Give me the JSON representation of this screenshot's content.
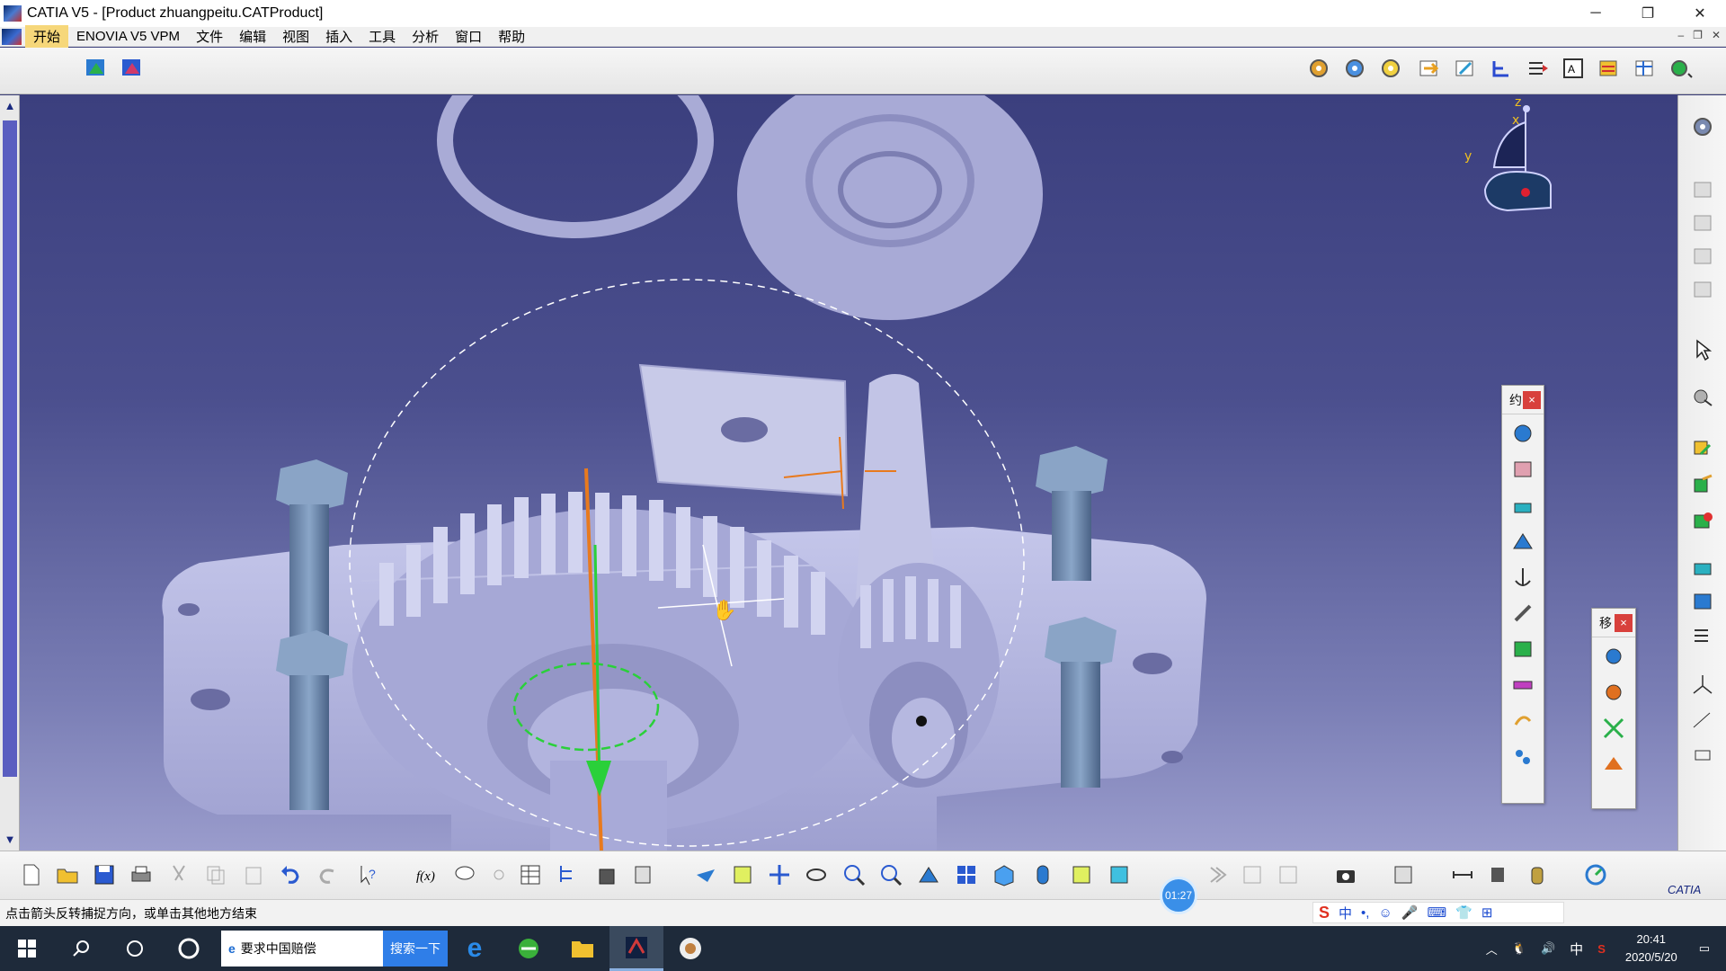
{
  "window": {
    "title": "CATIA V5 - [Product zhuangpeitu.CATProduct]",
    "controls": [
      "─",
      "❐",
      "✕"
    ]
  },
  "menu": {
    "items": [
      "开始",
      "ENOVIA V5 VPM",
      "文件",
      "编辑",
      "视图",
      "插入",
      "工具",
      "分析",
      "窗口",
      "帮助"
    ],
    "mdi_controls": [
      "–",
      "❐",
      "✕"
    ]
  },
  "compass": {
    "z": "z",
    "y": "y",
    "x": "x"
  },
  "panels": {
    "constraints_title": "约",
    "move_title": "移",
    "close": "×"
  },
  "status": {
    "message": "点击箭头反转捕捉方向，或单击其他地方结束",
    "timer": "01:27"
  },
  "catia_logo": "CATIA",
  "taskbar": {
    "search_text": "要求中国赔偿",
    "search_button": "搜索一下",
    "time": "20:41",
    "date": "2020/5/20",
    "ime_lang": "中",
    "ime_brand": "S",
    "ime_mode": "中"
  },
  "colors": {
    "viewport_top": "#3b3f7e",
    "part": "#b8badf",
    "bolt": "#7d96b8",
    "axis": "#e87a1e",
    "snap": "#2ad03a"
  }
}
